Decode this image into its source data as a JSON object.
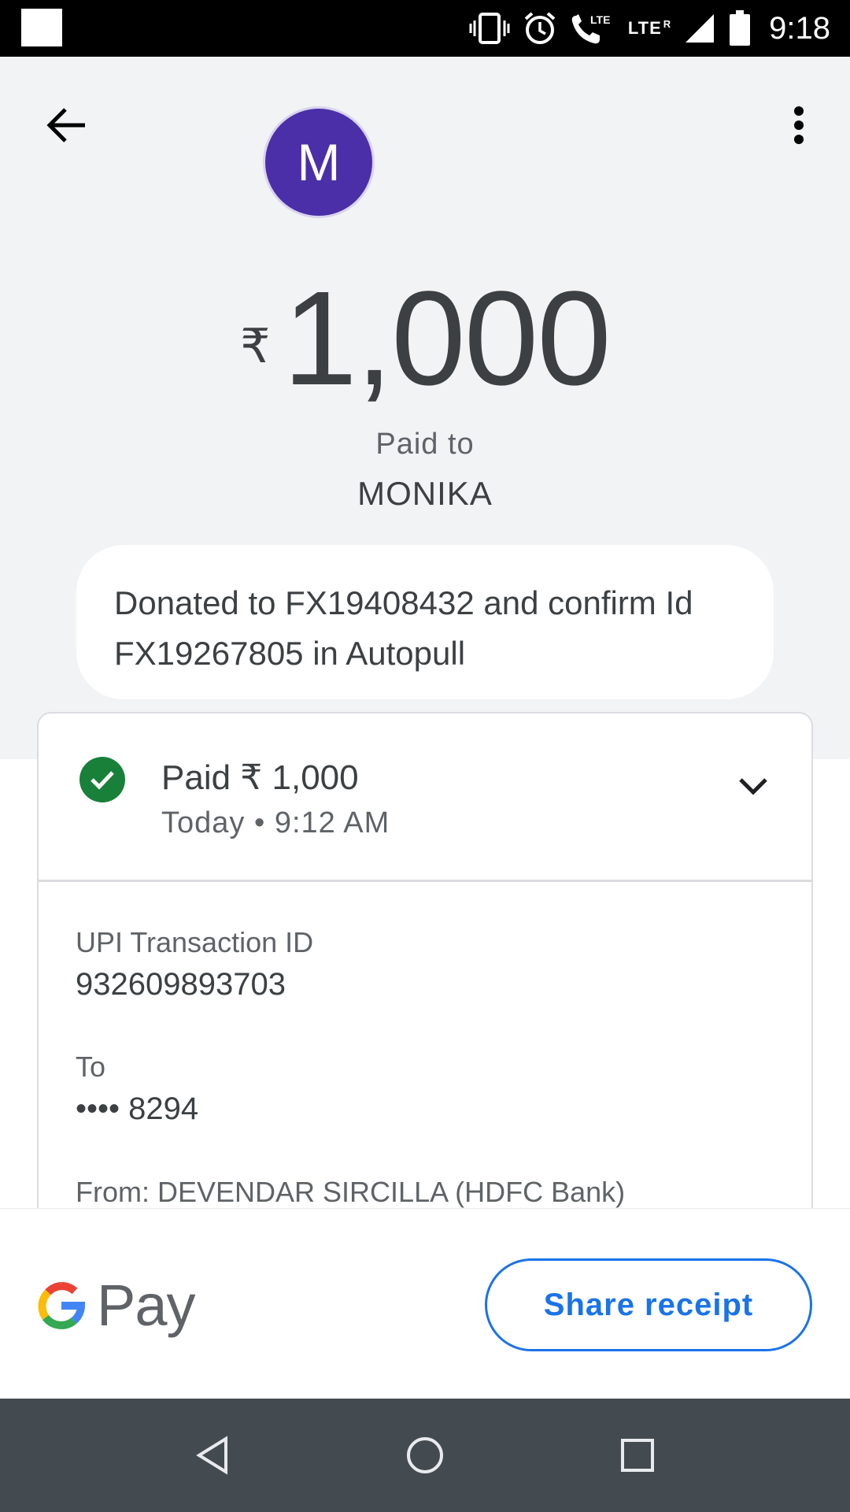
{
  "status_bar": {
    "time": "9:18",
    "network": "LTE",
    "roaming": "R"
  },
  "header": {
    "avatar_initial": "M",
    "avatar_color": "#4a2fa8"
  },
  "payment": {
    "currency_symbol": "₹",
    "amount": "1,000",
    "paid_to_label": "Paid to",
    "payee_name": "MONIKA",
    "note": "Donated to FX19408432 and confirm Id FX19267805 in Autopull"
  },
  "status_card": {
    "status_text": "Paid ₹ 1,000",
    "timestamp": "Today • 9:12 AM",
    "status_color": "#188038"
  },
  "details": {
    "upi_label": "UPI Transaction ID",
    "upi_value": "932609893703",
    "to_label": "To",
    "to_value": "•••• 8294",
    "from_text": "From: DEVENDAR SIRCILLA (HDFC Bank)"
  },
  "footer": {
    "brand": "Pay",
    "share_label": "Share receipt",
    "accent": "#1a73e8"
  },
  "icons": {
    "back": "arrow-left-icon",
    "more": "more-vert-icon",
    "expand": "chevron-down-icon",
    "check": "check-circle-icon"
  }
}
